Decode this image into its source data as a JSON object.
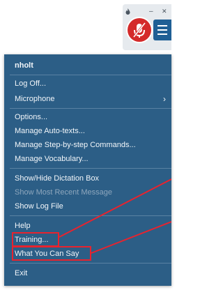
{
  "menu": {
    "username": "nholt",
    "items": [
      "Log Off...",
      "Microphone",
      "Options...",
      "Manage Auto-texts...",
      "Manage Step-by-step Commands...",
      "Manage Vocabulary...",
      "Show/Hide Dictation Box",
      "Show Most Recent Message",
      "Show Log File",
      "Help",
      "Training...",
      "What You Can Say",
      "Exit"
    ]
  },
  "toolbar": {
    "minimize_glyph": "–",
    "close_glyph": "✕"
  },
  "icons": {
    "microphone_off": "microphone-off-icon",
    "menu": "hamburger-menu-icon",
    "submenu": "chevron-right-icon",
    "app": "flame-icon"
  },
  "colors": {
    "menu_background": "#2c5e86",
    "microphone_button": "#d42a2a",
    "menu_button": "#1f5f95",
    "annotation": "#e8232e"
  }
}
